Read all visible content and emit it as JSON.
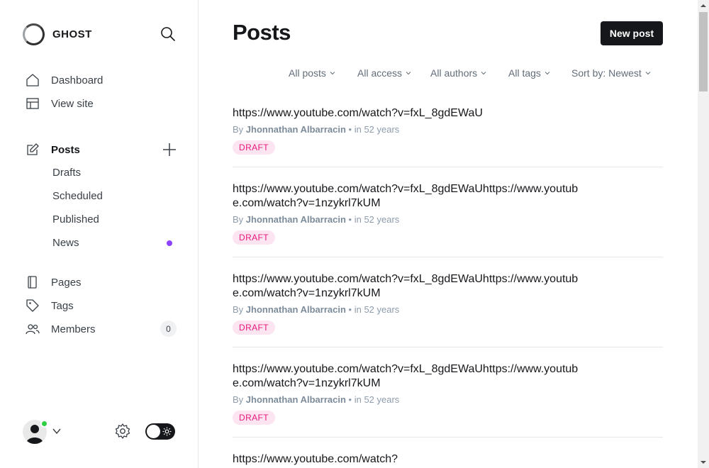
{
  "brand": {
    "name": "GHOST"
  },
  "nav": {
    "dashboard": "Dashboard",
    "view_site": "View site",
    "posts": "Posts",
    "drafts": "Drafts",
    "scheduled": "Scheduled",
    "published": "Published",
    "news": "News",
    "pages": "Pages",
    "tags": "Tags",
    "members": "Members",
    "members_count": "0"
  },
  "main": {
    "title": "Posts",
    "new_post_label": "New post",
    "filters": [
      "All posts",
      "All access",
      "All authors",
      "All tags",
      "Sort by: Newest"
    ]
  },
  "posts": [
    {
      "title": "https://www.youtube.com/watch?v=fxL_8gdEWaU",
      "by": "By",
      "author": "Jhonnathan Albarracin",
      "sep": "•",
      "time": "in 52 years",
      "status": "DRAFT"
    },
    {
      "title": "https://www.youtube.com/watch?v=fxL_8gdEWaUhttps://www.youtube.com/watch?v=1nzykrl7kUM",
      "by": "By",
      "author": "Jhonnathan Albarracin",
      "sep": "•",
      "time": "in 52 years",
      "status": "DRAFT"
    },
    {
      "title": "https://www.youtube.com/watch?v=fxL_8gdEWaUhttps://www.youtube.com/watch?v=1nzykrl7kUM",
      "by": "By",
      "author": "Jhonnathan Albarracin",
      "sep": "•",
      "time": "in 52 years",
      "status": "DRAFT"
    },
    {
      "title": "https://www.youtube.com/watch?v=fxL_8gdEWaUhttps://www.youtube.com/watch?v=1nzykrl7kUM",
      "by": "By",
      "author": "Jhonnathan Albarracin",
      "sep": "•",
      "time": "in 52 years",
      "status": "DRAFT"
    },
    {
      "title": "https://www.youtube.com/watch?",
      "by": "",
      "author": "",
      "sep": "",
      "time": "",
      "status": ""
    }
  ],
  "colors": {
    "accent": "#15171a",
    "draft_badge_bg": "#fce4f0",
    "draft_badge_text": "#e8187c",
    "news_dot": "#8e42ff",
    "online": "#30cf43"
  },
  "icons": {
    "search": "search-icon",
    "dashboard": "home-icon",
    "view_site": "layout-icon",
    "posts": "edit-icon",
    "add": "plus-icon",
    "pages": "page-icon",
    "tags": "tag-icon",
    "members": "members-icon",
    "settings": "gear-icon",
    "theme": "sun-icon",
    "chevron": "chevron-down-icon"
  }
}
